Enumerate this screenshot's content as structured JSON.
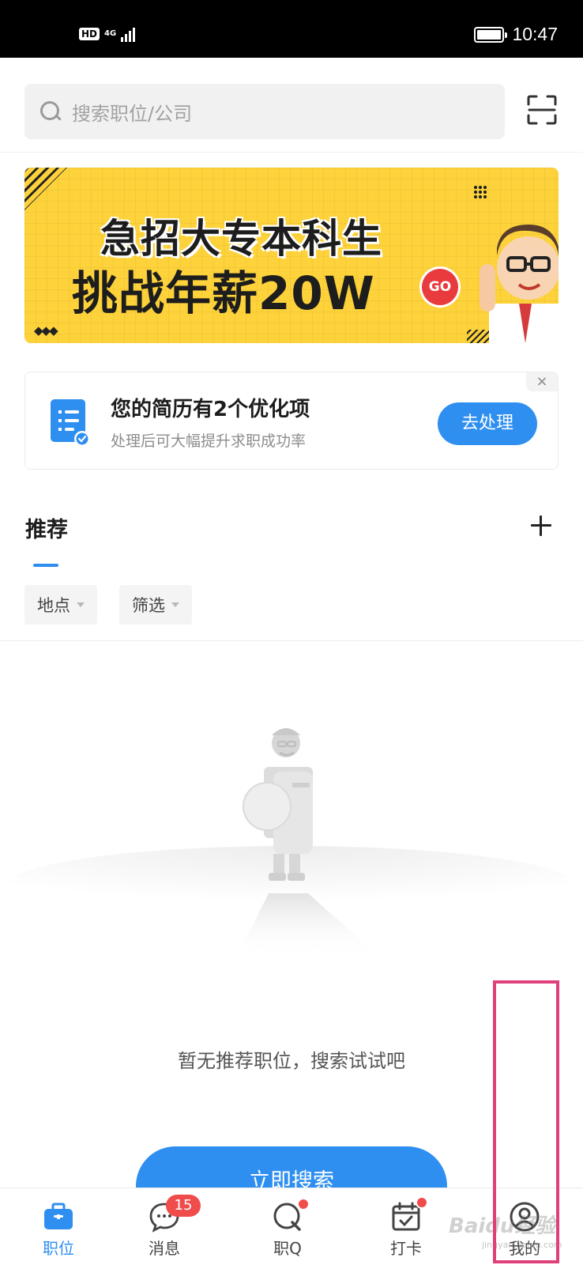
{
  "status_bar": {
    "hd": "HD",
    "network": "4G",
    "time": "10:47",
    "battery_level": 1.0
  },
  "search": {
    "placeholder": "搜索职位/公司",
    "scan_icon": "scan-icon"
  },
  "banner": {
    "line1": "急招大专本科生",
    "line2": "挑战年薪20W",
    "go": "GO",
    "accent": "#fdd23a"
  },
  "resume_card": {
    "title": "您的简历有2个优化项",
    "subtitle": "处理后可大幅提升求职成功率",
    "button": "去处理",
    "close": "×",
    "icon": "document-check-icon"
  },
  "recommend": {
    "tab": "推荐",
    "filters": [
      {
        "label": "地点"
      },
      {
        "label": "筛选"
      }
    ]
  },
  "empty_state": {
    "message": "暂无推荐职位，搜索试试吧",
    "button": "立即搜索"
  },
  "bottom_nav": {
    "items": [
      {
        "label": "职位",
        "icon": "briefcase-icon",
        "active": true
      },
      {
        "label": "消息",
        "icon": "chat-icon",
        "badge": "15"
      },
      {
        "label": "职Q",
        "icon": "q-icon",
        "dot": true
      },
      {
        "label": "打卡",
        "icon": "calendar-check-icon",
        "dot": true
      },
      {
        "label": "我的",
        "icon": "user-icon"
      }
    ]
  },
  "watermark": {
    "text": "Baidu经验",
    "sub": "jingyan.baidu.com"
  },
  "colors": {
    "primary": "#2e8ff0",
    "badge": "#f04c4c",
    "highlight": "#e0407a"
  }
}
